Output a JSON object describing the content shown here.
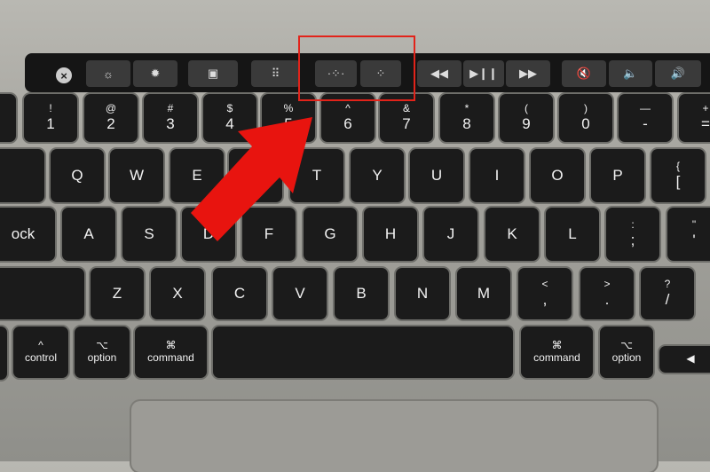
{
  "touch_bar": {
    "esc": "×",
    "buttons": [
      {
        "name": "brightness-down",
        "glyph": "☼"
      },
      {
        "name": "brightness-up",
        "glyph": "✹"
      },
      {
        "name": "mission-control",
        "glyph": "▣"
      },
      {
        "name": "launchpad",
        "glyph": "⠿"
      },
      {
        "name": "keyboard-illumination-down",
        "glyph": "·⁘·"
      },
      {
        "name": "keyboard-illumination-up",
        "glyph": "⁘"
      },
      {
        "name": "rewind",
        "glyph": "◀◀"
      },
      {
        "name": "play-pause",
        "glyph": "▶❙❙"
      },
      {
        "name": "fast-forward",
        "glyph": "▶▶"
      },
      {
        "name": "mute",
        "glyph": "🔇"
      },
      {
        "name": "volume-down",
        "glyph": "🔈"
      },
      {
        "name": "volume-up",
        "glyph": "🔊"
      }
    ]
  },
  "keys": {
    "row1": [
      [
        "!",
        "1"
      ],
      [
        "@",
        "2"
      ],
      [
        "#",
        "3"
      ],
      [
        "$",
        "4"
      ],
      [
        "%",
        "5"
      ],
      [
        "^",
        "6"
      ],
      [
        "&",
        "7"
      ],
      [
        "*",
        "8"
      ],
      [
        "(",
        "9"
      ],
      [
        ")",
        "0"
      ],
      [
        "—",
        "-"
      ],
      [
        "+",
        "="
      ]
    ],
    "row2": [
      "Q",
      "W",
      "E",
      "R",
      "T",
      "Y",
      "U",
      "I",
      "O",
      "P",
      [
        "{",
        "["
      ]
    ],
    "row3": [
      "A",
      "S",
      "D",
      "F",
      "G",
      "H",
      "J",
      "K",
      "L",
      [
        ":",
        ";"
      ],
      [
        "\"",
        "'"
      ]
    ],
    "caps_partial": "ock",
    "row4": [
      "Z",
      "X",
      "C",
      "V",
      "B",
      "N",
      "M",
      [
        "<",
        ","
      ],
      [
        ">",
        "."
      ],
      [
        "?",
        "/"
      ]
    ],
    "row5": [
      [
        "^",
        "control"
      ],
      [
        "⌥",
        "option"
      ],
      [
        "⌘",
        "command"
      ],
      [
        "",
        ""
      ],
      [
        "⌘",
        "command"
      ],
      [
        "⌥",
        "option"
      ],
      [
        "",
        "◀"
      ]
    ]
  },
  "annotation": {
    "color": "#e2231a"
  }
}
